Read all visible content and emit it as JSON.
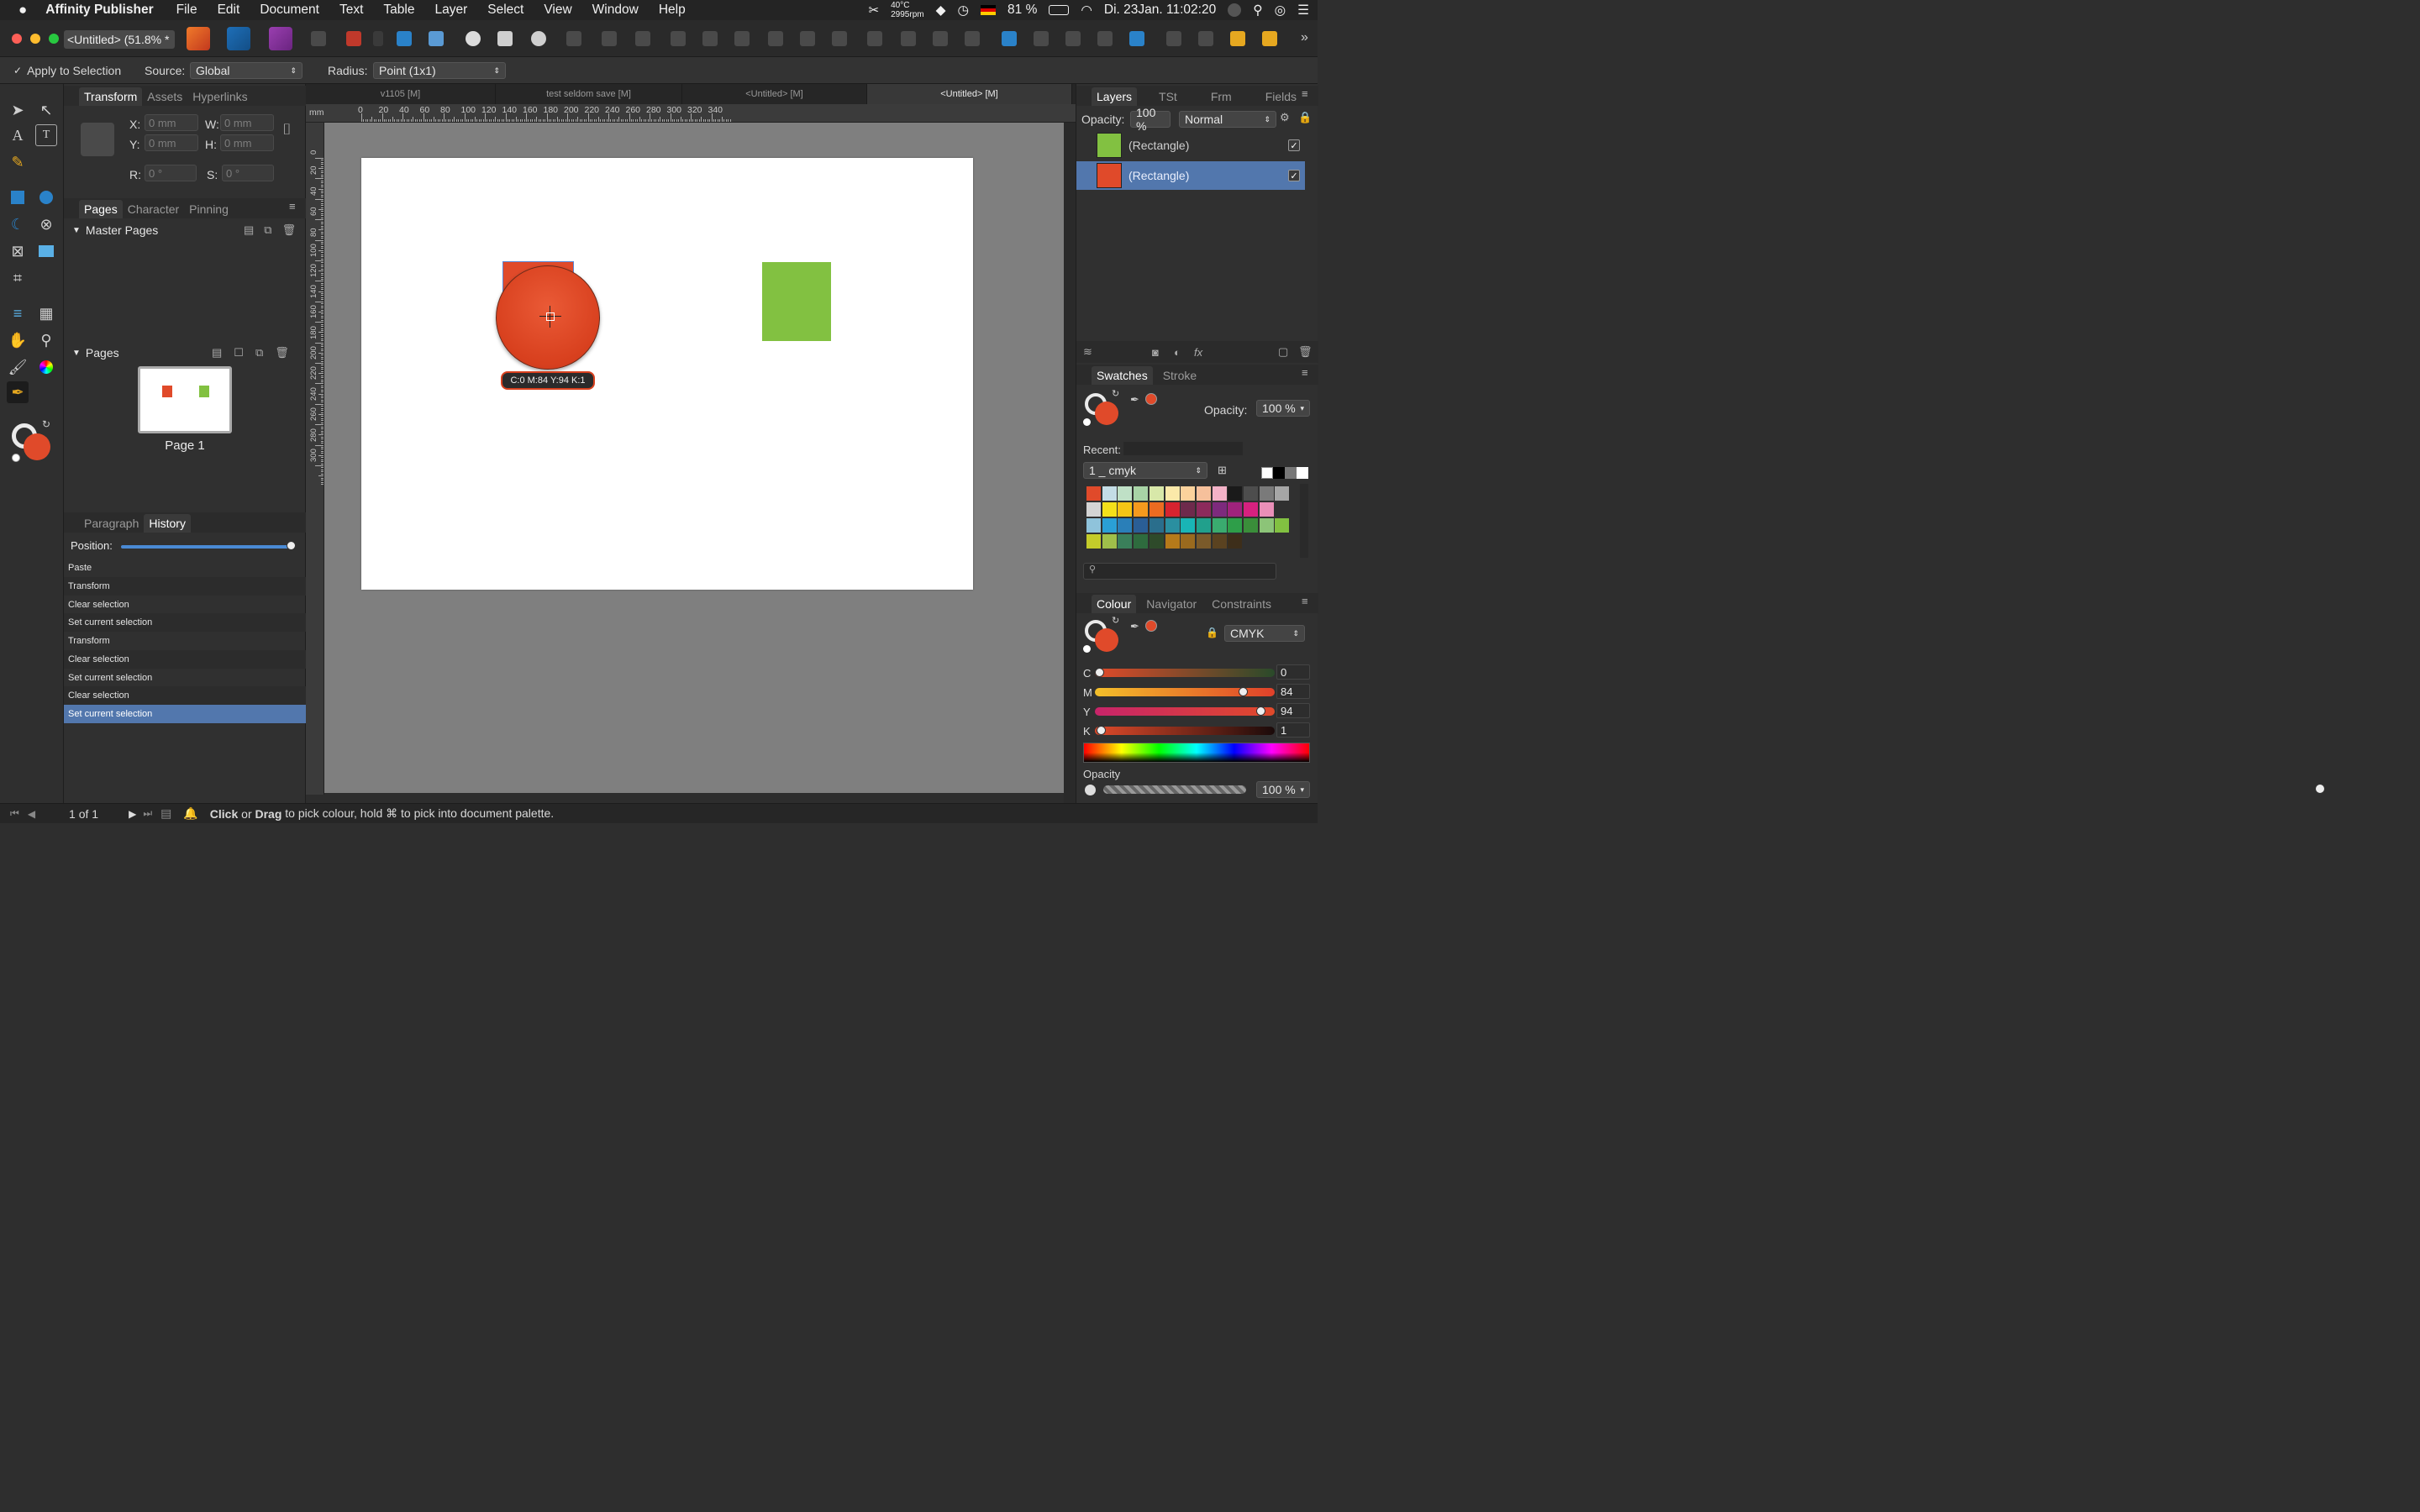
{
  "menubar": {
    "app_name": "Affinity Publisher",
    "items": [
      "File",
      "Edit",
      "Document",
      "Text",
      "Table",
      "Layer",
      "Select",
      "View",
      "Window",
      "Help"
    ],
    "temp": "40°C",
    "rpm": "2995rpm",
    "battery": "81 %",
    "clock": "Di. 23Jan.  11:02:20"
  },
  "window": {
    "title": "<Untitled> (51.8% *"
  },
  "context": {
    "apply_label": "Apply to Selection",
    "apply_checked": "✓",
    "source_label": "Source:",
    "source_value": "Global",
    "radius_label": "Radius:",
    "radius_value": "Point (1x1)"
  },
  "transform_panel": {
    "tabs": [
      "Transform",
      "Assets",
      "Hyperlinks"
    ],
    "x_label": "X:",
    "x_value": "0 mm",
    "y_label": "Y:",
    "y_value": "0 mm",
    "w_label": "W:",
    "w_value": "0 mm",
    "h_label": "H:",
    "h_value": "0 mm",
    "r_label": "R:",
    "r_value": "0 °",
    "s_label": "S:",
    "s_value": "0 °"
  },
  "pages_panel": {
    "tabs": [
      "Pages",
      "Character",
      "Pinning"
    ],
    "master_pages_label": "Master Pages",
    "pages_label": "Pages",
    "page_name": "Page 1"
  },
  "history_panel": {
    "tabs": [
      "Paragraph",
      "History"
    ],
    "position_label": "Position:",
    "position_fraction": 1.0,
    "items": [
      "Paste",
      "Transform",
      "Clear selection",
      "Set current selection",
      "Transform",
      "Clear selection",
      "Set current selection",
      "Clear selection",
      "Set current selection"
    ],
    "selected_index": 8
  },
  "doc_tabs": [
    "v1105  [M]",
    "test seldom save [M]",
    "<Untitled> [M]",
    "<Untitled> [M]"
  ],
  "rulers": {
    "unit": "mm",
    "h_ticks": [
      "0",
      "20",
      "40",
      "60",
      "80",
      "100",
      "120",
      "140",
      "160",
      "180",
      "200",
      "220",
      "240",
      "260",
      "280",
      "300",
      "320",
      "340"
    ],
    "v_ticks": [
      "0",
      "20",
      "40",
      "60",
      "80",
      "100",
      "120",
      "140",
      "160",
      "180",
      "200",
      "220",
      "240",
      "260",
      "280",
      "300"
    ]
  },
  "canvas": {
    "picker_readout": "C:0 M:84 Y:94 K:1",
    "red_color": "#e04a2a",
    "green_color": "#82c141"
  },
  "layers_panel": {
    "tabs": [
      "Layers",
      "TSt",
      "Frm",
      "Fields"
    ],
    "opacity_label": "Opacity:",
    "opacity_value": "100 %",
    "blend_mode": "Normal",
    "layers": [
      {
        "name": "(Rectangle)",
        "color": "#82c141",
        "checked": "✓"
      },
      {
        "name": "(Rectangle)",
        "color": "#e04a2a",
        "checked": "✓"
      }
    ]
  },
  "swatches_panel": {
    "tabs": [
      "Swatches",
      "Stroke"
    ],
    "opacity_label": "Opacity:",
    "opacity_value": "100 %",
    "recent_label": "Recent:",
    "palette_name": "1 _ cmyk",
    "swatch_rows": [
      [
        "#e04a2a",
        "#c4dde6",
        "#bfe0c6",
        "#a8d4a6",
        "#d8e8a9",
        "#fbe9a9",
        "#fbd29c",
        "#f6c09b",
        "#f3b2c7",
        "#1a1a1a",
        "#4d4d4d",
        "#7a7a7a",
        "#a6a6a6"
      ],
      [
        "#d4d4d4",
        "#f4e01a",
        "#f6c515",
        "#f49a1e",
        "#ec6b21",
        "#d7232f",
        "#6e2a4c",
        "#8c2a5c",
        "#7d2a7d",
        "#a0237c",
        "#d6217f",
        "#ea8fb8"
      ],
      [
        "#8fc3db",
        "#2a9fd6",
        "#2a7fb8",
        "#2a5e96",
        "#2a6e8c",
        "#2a8fa0",
        "#19b5b5",
        "#21a08c",
        "#3aab6f",
        "#2e9e49",
        "#3a8e3a",
        "#8cc478",
        "#82c141"
      ],
      [
        "#c4cc2a",
        "#9fbf4a",
        "#3a7f5a",
        "#2e6b3e",
        "#2e4a2a",
        "#b57a1a",
        "#9a6a1e",
        "#7a5a2a",
        "#5a4220",
        "#3d2e1a"
      ]
    ]
  },
  "colour_panel": {
    "tabs": [
      "Colour",
      "Navigator",
      "Constraints"
    ],
    "model": "CMYK",
    "channels": [
      {
        "label": "C",
        "value": "0",
        "fraction": 0.0
      },
      {
        "label": "M",
        "value": "84",
        "fraction": 0.84
      },
      {
        "label": "Y",
        "value": "94",
        "fraction": 0.94
      },
      {
        "label": "K",
        "value": "1",
        "fraction": 0.01
      }
    ],
    "opacity_label": "Opacity",
    "opacity_value": "100 %",
    "opacity_fraction": 1.0
  },
  "statusbar": {
    "page_count": "1 of 1",
    "hint_click": "Click",
    "hint_or": " or ",
    "hint_drag": "Drag",
    "hint_rest": " to pick colour, hold ⌘ to pick into document palette."
  }
}
